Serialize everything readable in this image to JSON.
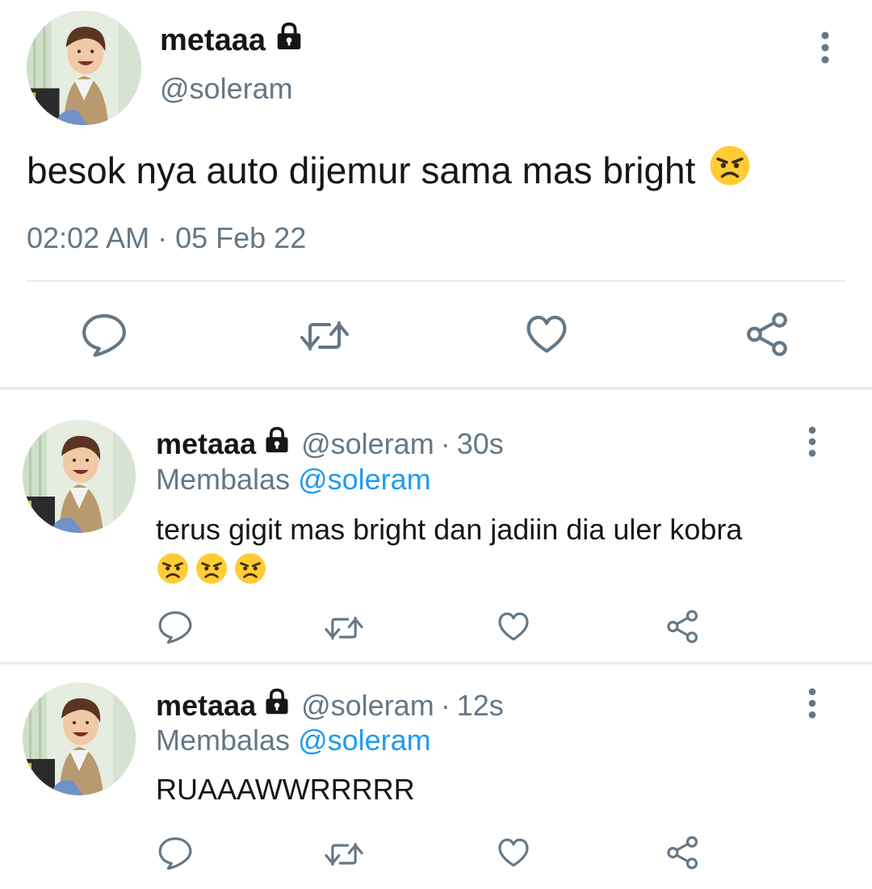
{
  "main_tweet": {
    "display_name": "metaaa",
    "handle": "@soleram",
    "text": "besok nya auto dijemur sama mas bright",
    "emoji": "angry-face",
    "meta": "02:02 AM · 05 Feb 22"
  },
  "replies": [
    {
      "display_name": "metaaa",
      "handle": "@soleram",
      "separator": "·",
      "time": "30s",
      "reply_prefix": "Membalas",
      "reply_mention": "@soleram",
      "text": "terus gigit mas bright dan jadiin dia uler kobra",
      "emoji_count": 3
    },
    {
      "display_name": "metaaa",
      "handle": "@soleram",
      "separator": "·",
      "time": "12s",
      "reply_prefix": "Membalas",
      "reply_mention": "@soleram",
      "text": "RUAAAWWRRRRR",
      "emoji_count": 0
    }
  ],
  "icons": {
    "reply": "reply-icon",
    "retweet": "retweet-icon",
    "like": "like-icon",
    "share": "share-icon",
    "more": "more-vertical-icon",
    "lock": "lock-icon"
  },
  "colors": {
    "text": "#14171a",
    "secondary": "#657786",
    "mention": "#1d9bf0",
    "divider": "#e6ecf0",
    "emoji_face": "#ffcc33"
  }
}
